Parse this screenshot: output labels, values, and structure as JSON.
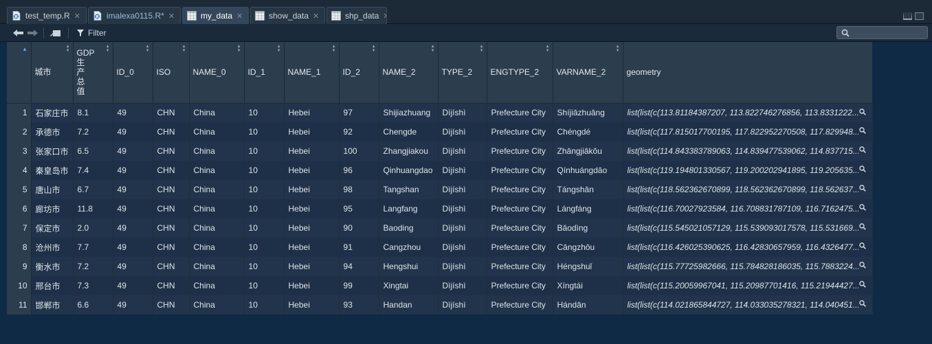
{
  "tabs": [
    {
      "label": "test_temp.R",
      "type": "r-file",
      "active": false,
      "modified": false
    },
    {
      "label": "imalexa0115.R*",
      "type": "r-file",
      "active": false,
      "modified": true
    },
    {
      "label": "my_data",
      "type": "data",
      "active": true,
      "modified": false
    },
    {
      "label": "show_data",
      "type": "data",
      "active": false,
      "modified": false
    },
    {
      "label": "shp_data",
      "type": "data",
      "active": false,
      "modified": false
    }
  ],
  "toolbar": {
    "filter_label": "Filter",
    "search_placeholder": "",
    "search_value": ""
  },
  "table": {
    "columns": [
      "城市",
      "GDP\n生\n产\n总\n值",
      "ID_0",
      "ISO",
      "NAME_0",
      "ID_1",
      "NAME_1",
      "ID_2",
      "NAME_2",
      "TYPE_2",
      "ENGTYPE_2",
      "VARNAME_2",
      "geometry"
    ],
    "rows": [
      [
        "1",
        "石家庄市",
        "8.1",
        "49",
        "CHN",
        "China",
        "10",
        "Hebei",
        "97",
        "Shijiazhuang",
        "Dìjíshì",
        "Prefecture City",
        "Shíjiāzhuāng",
        "list(list(c(113.81184387207, 113.822746276856, 113.8331222..."
      ],
      [
        "2",
        "承德市",
        "7.2",
        "49",
        "CHN",
        "China",
        "10",
        "Hebei",
        "92",
        "Chengde",
        "Dìjíshì",
        "Prefecture City",
        "Chéngdé",
        "list(list(c(117.815017700195, 117.822952270508, 117.829948..."
      ],
      [
        "3",
        "张家口市",
        "6.5",
        "49",
        "CHN",
        "China",
        "10",
        "Hebei",
        "100",
        "Zhangjiakou",
        "Dìjíshì",
        "Prefecture City",
        "Zhāngjiākǒu",
        "list(list(c(114.843383789063, 114.839477539062, 114.837715..."
      ],
      [
        "4",
        "秦皇岛市",
        "7.4",
        "49",
        "CHN",
        "China",
        "10",
        "Hebei",
        "96",
        "Qinhuangdao",
        "Dìjíshì",
        "Prefecture City",
        "Qínhuángdǎo",
        "list(list(c(119.194801330567, 119.200202941895, 119.205635..."
      ],
      [
        "5",
        "唐山市",
        "6.7",
        "49",
        "CHN",
        "China",
        "10",
        "Hebei",
        "98",
        "Tangshan",
        "Dìjíshì",
        "Prefecture City",
        "Tángshān",
        "list(list(c(118.562362670899, 118.562362670899, 118.562637..."
      ],
      [
        "6",
        "廊坊市",
        "11.8",
        "49",
        "CHN",
        "China",
        "10",
        "Hebei",
        "95",
        "Langfang",
        "Dìjíshì",
        "Prefecture City",
        "Lángfáng",
        "list(list(c(116.70027923584, 116.708831787109, 116.7162475..."
      ],
      [
        "7",
        "保定市",
        "2.0",
        "49",
        "CHN",
        "China",
        "10",
        "Hebei",
        "90",
        "Baoding",
        "Dìjíshì",
        "Prefecture City",
        "Bǎodìng",
        "list(list(c(115.545021057129, 115.539093017578, 115.531669..."
      ],
      [
        "8",
        "沧州市",
        "7.7",
        "49",
        "CHN",
        "China",
        "10",
        "Hebei",
        "91",
        "Cangzhou",
        "Dìjíshì",
        "Prefecture City",
        "Cāngzhōu",
        "list(list(c(116.426025390625, 116.42830657959, 116.4326477..."
      ],
      [
        "9",
        "衡水市",
        "7.2",
        "49",
        "CHN",
        "China",
        "10",
        "Hebei",
        "94",
        "Hengshui",
        "Dìjíshì",
        "Prefecture City",
        "Héngshuǐ",
        "list(list(c(115.77725982666, 115.784828186035, 115.7883224..."
      ],
      [
        "10",
        "邢台市",
        "7.3",
        "49",
        "CHN",
        "China",
        "10",
        "Hebei",
        "99",
        "Xingtai",
        "Dìjíshì",
        "Prefecture City",
        "Xíngtái",
        "list(list(c(115.20059967041, 115.20987701416, 115.21944427..."
      ],
      [
        "11",
        "邯郸市",
        "6.6",
        "49",
        "CHN",
        "China",
        "10",
        "Hebei",
        "93",
        "Handan",
        "Dìjíshì",
        "Prefecture City",
        "Hándān",
        "list(list(c(114.021865844727, 114.033035278321, 114.040451..."
      ]
    ]
  },
  "colors": {
    "background": "#0f2a45",
    "header_bg": "#2c3d4e",
    "row_bg": "#21344b",
    "accent": "#6ba3e8"
  },
  "icons": [
    "r-file-icon",
    "data-table-icon",
    "close-icon",
    "back-arrow-icon",
    "forward-arrow-icon",
    "show-in-window-icon",
    "filter-icon",
    "search-icon",
    "sort-icon",
    "zoom-icon",
    "minimize-icon",
    "maximize-icon"
  ]
}
